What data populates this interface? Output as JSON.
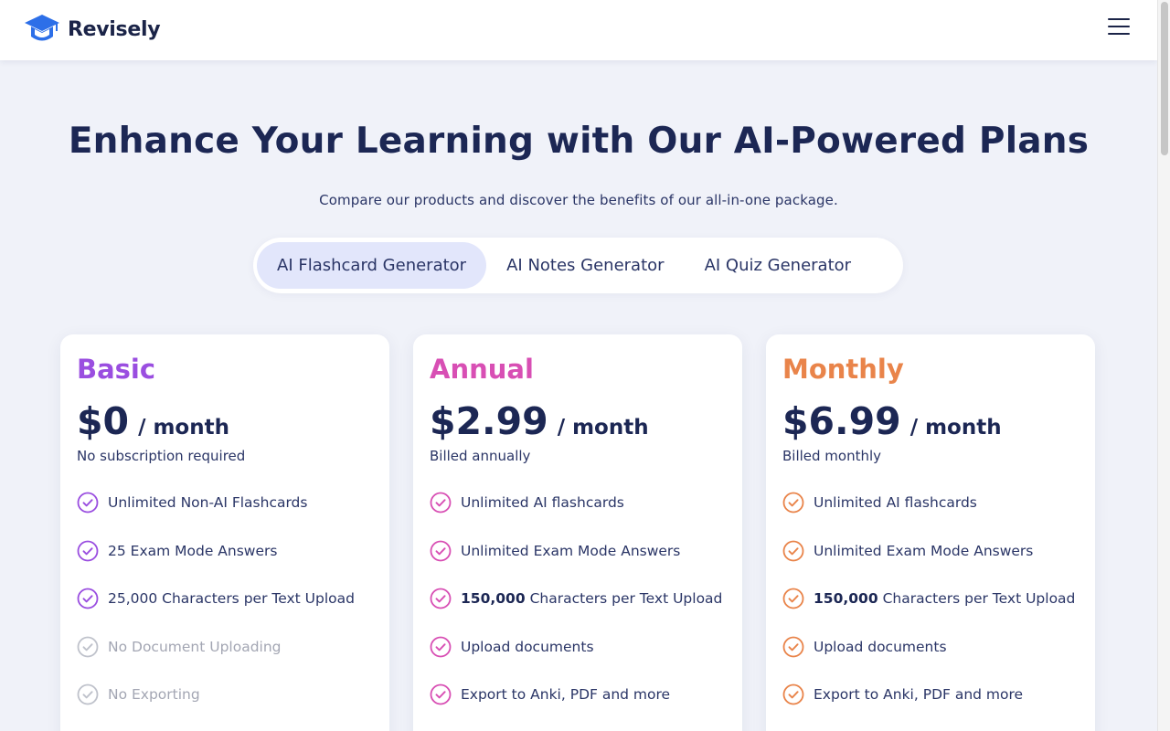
{
  "app": {
    "name": "Revisely"
  },
  "colors": {
    "basic": "#9a4ee0",
    "annual": "#d84fb4",
    "monthly": "#e9844a",
    "disabled": "#bfc2cb",
    "text": "#1c2754",
    "tab_active_bg": "#e2e6fb",
    "logo": "#2d6fe8"
  },
  "header": {
    "menu_icon": "hamburger-menu-icon"
  },
  "hero": {
    "title": "Enhance Your Learning with Our AI-Powered Plans",
    "subtitle": "Compare our products and discover the benefits of our all-in-one package."
  },
  "tabs": [
    {
      "label": "AI Flashcard Generator",
      "active": true
    },
    {
      "label": "AI Notes Generator",
      "active": false
    },
    {
      "label": "AI Quiz Generator",
      "active": false
    }
  ],
  "plans": [
    {
      "name": "Basic",
      "price": "$0",
      "period": "/ month",
      "billing": "No subscription required",
      "features": [
        {
          "bold": "",
          "text": "Unlimited Non-AI Flashcards",
          "included": true
        },
        {
          "bold": "",
          "text": "25 Exam Mode Answers",
          "included": true
        },
        {
          "bold": "",
          "text": "25,000 Characters per Text Upload",
          "included": true
        },
        {
          "bold": "",
          "text": "No Document Uploading",
          "included": false
        },
        {
          "bold": "",
          "text": "No Exporting",
          "included": false
        }
      ]
    },
    {
      "name": "Annual",
      "price": "$2.99",
      "period": "/ month",
      "billing": "Billed annually",
      "features": [
        {
          "bold": "",
          "text": "Unlimited AI flashcards",
          "included": true
        },
        {
          "bold": "",
          "text": "Unlimited Exam Mode Answers",
          "included": true
        },
        {
          "bold": "150,000",
          "text": "Characters per Text Upload",
          "included": true
        },
        {
          "bold": "",
          "text": "Upload documents",
          "included": true
        },
        {
          "bold": "",
          "text": "Export to Anki, PDF and more",
          "included": true
        }
      ]
    },
    {
      "name": "Monthly",
      "price": "$6.99",
      "period": "/ month",
      "billing": "Billed monthly",
      "features": [
        {
          "bold": "",
          "text": "Unlimited AI flashcards",
          "included": true
        },
        {
          "bold": "",
          "text": "Unlimited Exam Mode Answers",
          "included": true
        },
        {
          "bold": "150,000",
          "text": "Characters per Text Upload",
          "included": true
        },
        {
          "bold": "",
          "text": "Upload documents",
          "included": true
        },
        {
          "bold": "",
          "text": "Export to Anki, PDF and more",
          "included": true
        }
      ]
    }
  ]
}
